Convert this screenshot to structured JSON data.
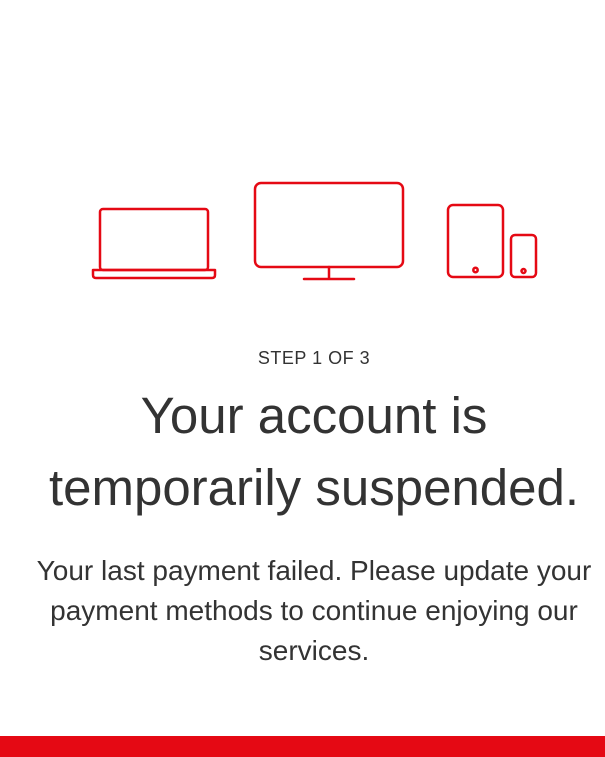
{
  "accent_color": "#e50914",
  "devices": {
    "icons": [
      "laptop-icon",
      "tv-monitor-icon",
      "tablet-icon",
      "phone-icon"
    ]
  },
  "step": {
    "label": "STEP 1 OF 3"
  },
  "headline": {
    "line1": "Your account is",
    "line2": "temporarily suspended."
  },
  "message": {
    "line1": "Your last payment failed. Please update your",
    "line2": "payment methods to continue enjoying our",
    "line3": "services."
  }
}
